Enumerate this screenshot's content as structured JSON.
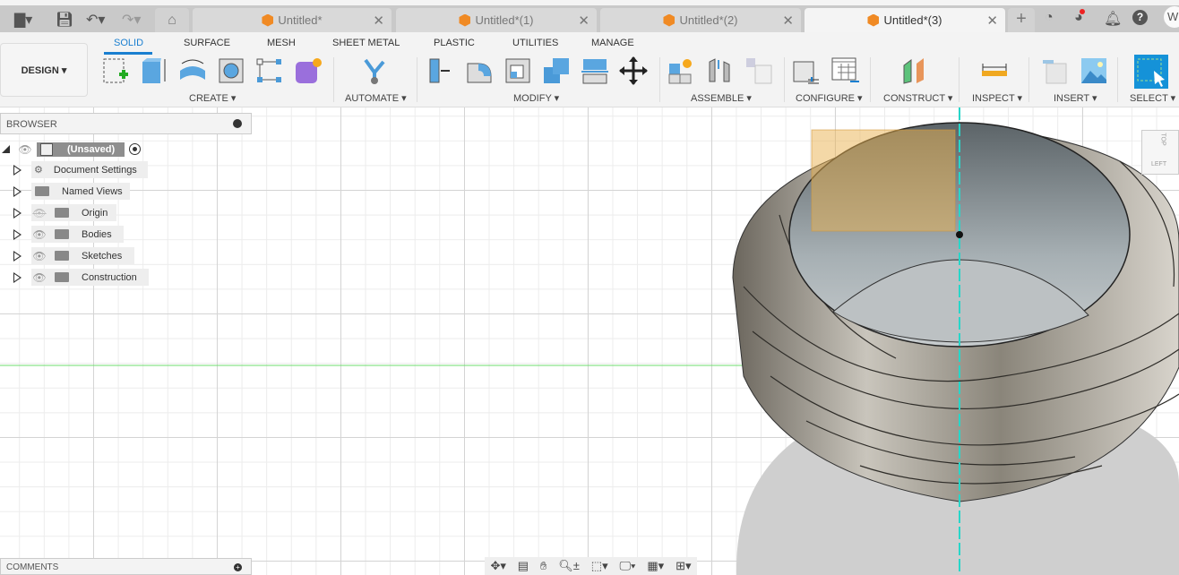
{
  "quick_access": {
    "file": "file-icon",
    "save": "save-icon",
    "undo": "undo-icon",
    "redo": "redo-icon",
    "home": "home-icon"
  },
  "tabs": [
    {
      "label": "Untitled*"
    },
    {
      "label": "Untitled*(1)"
    },
    {
      "label": "Untitled*(2)"
    },
    {
      "label": "Untitled*(3)",
      "active": true
    }
  ],
  "user_initial": "W",
  "workspace": "DESIGN ▾",
  "toolbar_tabs": [
    "SOLID",
    "SURFACE",
    "MESH",
    "SHEET METAL",
    "PLASTIC",
    "UTILITIES",
    "MANAGE"
  ],
  "groups": [
    "CREATE ▾",
    "AUTOMATE ▾",
    "MODIFY ▾",
    "ASSEMBLE ▾",
    "CONFIGURE ▾",
    "CONSTRUCT ▾",
    "INSPECT ▾",
    "INSERT ▾",
    "SELECT ▾"
  ],
  "browser": {
    "title": "BROWSER",
    "root": "(Unsaved)",
    "items": [
      "Document Settings",
      "Named Views",
      "Origin",
      "Bodies",
      "Sketches",
      "Construction"
    ]
  },
  "comments": "COMMENTS",
  "viewcube": {
    "top": "TOP",
    "left": "LEFT"
  },
  "colors": {
    "accent": "#1a7fd0",
    "tab_icon": "#f08a24",
    "axis_green": "#6fdc6f",
    "axis_cyan": "#27d6c9"
  }
}
